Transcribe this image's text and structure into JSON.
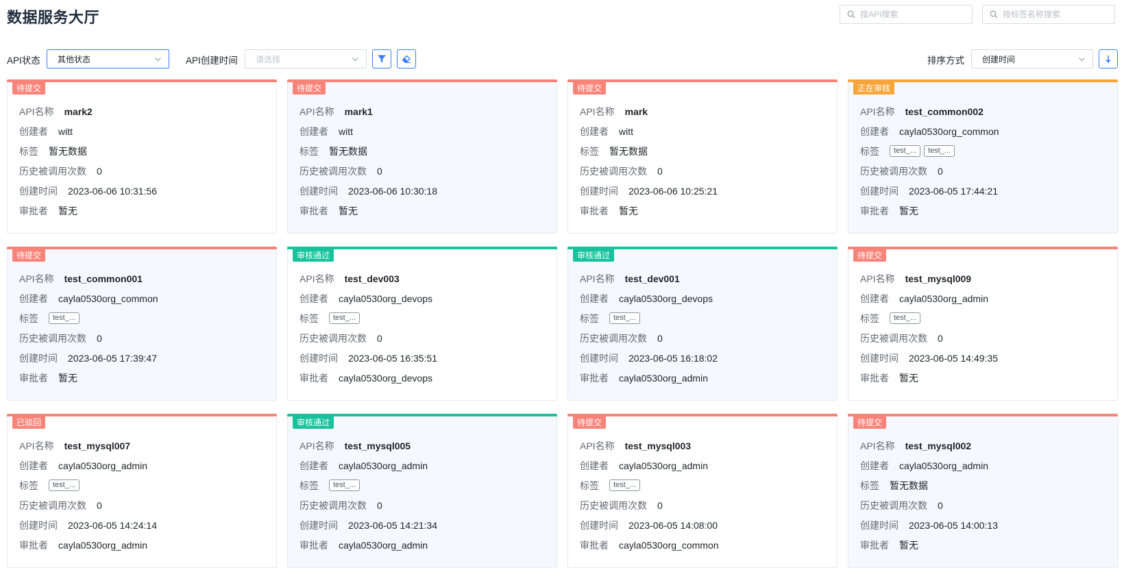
{
  "page": {
    "title": "数据服务大厅"
  },
  "search": {
    "api_placeholder": "按API搜索",
    "tag_placeholder": "按标签名称搜索"
  },
  "filters": {
    "status_label": "API状态",
    "status_value": "其他状态",
    "time_label": "API创建时间",
    "time_placeholder": "请选择",
    "sort_label": "排序方式",
    "sort_value": "创建时间"
  },
  "icons": {
    "filter": "filter-icon",
    "clear": "eraser-icon",
    "sort": "arrow-down-icon",
    "search": "search-icon",
    "chevron": "chevron-down-icon"
  },
  "status_colors": {
    "待提交": "#f88379",
    "已驳回": "#f88379",
    "正在审核": "#f7a53b",
    "审核通过": "#17c29c"
  },
  "field_labels": {
    "name": "API名称",
    "creator": "创建者",
    "tags": "标签",
    "calls": "历史被调用次数",
    "created": "创建时间",
    "approver": "审批者"
  },
  "cards": [
    {
      "status": "待提交",
      "name": "mark2",
      "creator": "witt",
      "tags": [],
      "tags_empty": "暂无数据",
      "calls": "0",
      "created": "2023-06-06 10:31:56",
      "approver": "暂无",
      "alt": false
    },
    {
      "status": "待提交",
      "name": "mark1",
      "creator": "witt",
      "tags": [],
      "tags_empty": "暂无数据",
      "calls": "0",
      "created": "2023-06-06 10:30:18",
      "approver": "暂无",
      "alt": true
    },
    {
      "status": "待提交",
      "name": "mark",
      "creator": "witt",
      "tags": [],
      "tags_empty": "暂无数据",
      "calls": "0",
      "created": "2023-06-06 10:25:21",
      "approver": "暂无",
      "alt": false
    },
    {
      "status": "正在审核",
      "name": "test_common002",
      "creator": "cayla0530org_common",
      "tags": [
        "test_...",
        "test_..."
      ],
      "tags_empty": "",
      "calls": "0",
      "created": "2023-06-05 17:44:21",
      "approver": "暂无",
      "alt": true
    },
    {
      "status": "待提交",
      "name": "test_common001",
      "creator": "cayla0530org_common",
      "tags": [
        "test_..."
      ],
      "tags_empty": "",
      "calls": "0",
      "created": "2023-06-05 17:39:47",
      "approver": "暂无",
      "alt": true
    },
    {
      "status": "审核通过",
      "name": "test_dev003",
      "creator": "cayla0530org_devops",
      "tags": [
        "test_..."
      ],
      "tags_empty": "",
      "calls": "0",
      "created": "2023-06-05 16:35:51",
      "approver": "cayla0530org_devops",
      "alt": false
    },
    {
      "status": "审核通过",
      "name": "test_dev001",
      "creator": "cayla0530org_devops",
      "tags": [
        "test_..."
      ],
      "tags_empty": "",
      "calls": "0",
      "created": "2023-06-05 16:18:02",
      "approver": "cayla0530org_admin",
      "alt": true
    },
    {
      "status": "待提交",
      "name": "test_mysql009",
      "creator": "cayla0530org_admin",
      "tags": [
        "test_..."
      ],
      "tags_empty": "",
      "calls": "0",
      "created": "2023-06-05 14:49:35",
      "approver": "暂无",
      "alt": false
    },
    {
      "status": "已驳回",
      "name": "test_mysql007",
      "creator": "cayla0530org_admin",
      "tags": [
        "test_..."
      ],
      "tags_empty": "",
      "calls": "0",
      "created": "2023-06-05 14:24:14",
      "approver": "cayla0530org_admin",
      "alt": false
    },
    {
      "status": "审核通过",
      "name": "test_mysql005",
      "creator": "cayla0530org_admin",
      "tags": [
        "test_..."
      ],
      "tags_empty": "",
      "calls": "0",
      "created": "2023-06-05 14:21:34",
      "approver": "cayla0530org_admin",
      "alt": true
    },
    {
      "status": "待提交",
      "name": "test_mysql003",
      "creator": "cayla0530org_admin",
      "tags": [
        "test_..."
      ],
      "tags_empty": "",
      "calls": "0",
      "created": "2023-06-05 14:08:00",
      "approver": "cayla0530org_common",
      "alt": false
    },
    {
      "status": "待提交",
      "name": "test_mysql002",
      "creator": "cayla0530org_admin",
      "tags": [],
      "tags_empty": "暂无数据",
      "calls": "0",
      "created": "2023-06-05 14:00:13",
      "approver": "暂无",
      "alt": true
    }
  ]
}
